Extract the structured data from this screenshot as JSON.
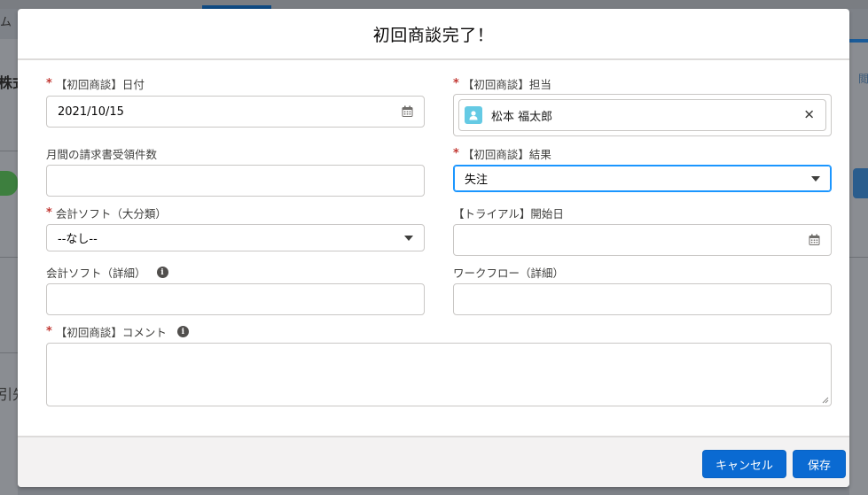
{
  "background": {
    "left_text_top": "ム",
    "left_text_bold": "株式",
    "left_text_bottom": "引先",
    "right_text": "閲"
  },
  "modal": {
    "title": "初回商談完了！"
  },
  "fields": {
    "first_meeting_date": {
      "label": "【初回商談】日付",
      "required": true,
      "value": "2021/10/15",
      "icon": "calendar-icon"
    },
    "first_meeting_owner": {
      "label": "【初回商談】担当",
      "required": true,
      "value": "松本 福太郎",
      "icon": "user-avatar-icon"
    },
    "monthly_invoice_count": {
      "label": "月間の請求書受領件数",
      "required": false,
      "value": ""
    },
    "first_meeting_result": {
      "label": "【初回商談】結果",
      "required": true,
      "value": "失注"
    },
    "accounting_software_category": {
      "label": "会計ソフト（大分類）",
      "required": true,
      "value": "--なし--"
    },
    "trial_start_date": {
      "label": "【トライアル】開始日",
      "required": false,
      "value": "",
      "icon": "calendar-icon"
    },
    "accounting_software_detail": {
      "label": "会計ソフト（詳細）",
      "required": false,
      "value": "",
      "icon": "info-icon"
    },
    "workflow_detail": {
      "label": "ワークフロー（詳細）",
      "required": false,
      "value": ""
    },
    "first_meeting_comment": {
      "label": "【初回商談】コメント",
      "required": true,
      "value": "",
      "icon": "info-icon"
    }
  },
  "footer": {
    "cancel_label": "キャンセル",
    "save_label": "保存"
  },
  "colors": {
    "brand_button": "#0a6ad2",
    "required_asterisk": "#c23934",
    "focus_border": "#1b96ff",
    "avatar_bg": "#65cae4"
  }
}
